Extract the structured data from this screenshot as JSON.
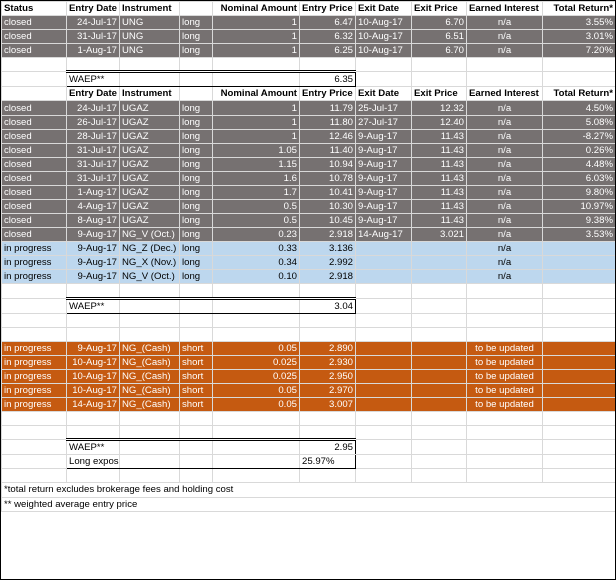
{
  "headers": [
    "Status",
    "Entry Date",
    "Instrument",
    "",
    "Nominal Amount",
    "Entry Price",
    "Exit Date",
    "Exit Price",
    "Earned Interest",
    "Total Return*"
  ],
  "sec1": [
    {
      "status": "closed",
      "entry_date": "24-Jul-17",
      "instrument": "UNG",
      "side": "long",
      "nominal": "1",
      "entry_price": "6.47",
      "exit_date": "10-Aug-17",
      "exit_price": "6.70",
      "interest": "n/a",
      "ret": "3.55%"
    },
    {
      "status": "closed",
      "entry_date": "31-Jul-17",
      "instrument": "UNG",
      "side": "long",
      "nominal": "1",
      "entry_price": "6.32",
      "exit_date": "10-Aug-17",
      "exit_price": "6.51",
      "interest": "n/a",
      "ret": "3.01%"
    },
    {
      "status": "closed",
      "entry_date": "1-Aug-17",
      "instrument": "UNG",
      "side": "long",
      "nominal": "1",
      "entry_price": "6.25",
      "exit_date": "10-Aug-17",
      "exit_price": "6.70",
      "interest": "n/a",
      "ret": "7.20%"
    }
  ],
  "waep1": {
    "label": "WAEP**",
    "value": "6.35"
  },
  "headers2": [
    "",
    "Entry Date",
    "Instrument",
    "",
    "Nominal Amount",
    "Entry Price",
    "Exit Date",
    "Exit Price",
    "Earned Interest",
    "Total Return*"
  ],
  "sec2_closed": [
    {
      "status": "closed",
      "entry_date": "24-Jul-17",
      "instrument": "UGAZ",
      "side": "long",
      "nominal": "1",
      "entry_price": "11.79",
      "exit_date": "25-Jul-17",
      "exit_price": "12.32",
      "interest": "n/a",
      "ret": "4.50%"
    },
    {
      "status": "closed",
      "entry_date": "26-Jul-17",
      "instrument": "UGAZ",
      "side": "long",
      "nominal": "1",
      "entry_price": "11.80",
      "exit_date": "27-Jul-17",
      "exit_price": "12.40",
      "interest": "n/a",
      "ret": "5.08%"
    },
    {
      "status": "closed",
      "entry_date": "28-Jul-17",
      "instrument": "UGAZ",
      "side": "long",
      "nominal": "1",
      "entry_price": "12.46",
      "exit_date": "9-Aug-17",
      "exit_price": "11.43",
      "interest": "n/a",
      "ret": "-8.27%"
    },
    {
      "status": "closed",
      "entry_date": "31-Jul-17",
      "instrument": "UGAZ",
      "side": "long",
      "nominal": "1.05",
      "entry_price": "11.40",
      "exit_date": "9-Aug-17",
      "exit_price": "11.43",
      "interest": "n/a",
      "ret": "0.26%"
    },
    {
      "status": "closed",
      "entry_date": "31-Jul-17",
      "instrument": "UGAZ",
      "side": "long",
      "nominal": "1.15",
      "entry_price": "10.94",
      "exit_date": "9-Aug-17",
      "exit_price": "11.43",
      "interest": "n/a",
      "ret": "4.48%"
    },
    {
      "status": "closed",
      "entry_date": "31-Jul-17",
      "instrument": "UGAZ",
      "side": "long",
      "nominal": "1.6",
      "entry_price": "10.78",
      "exit_date": "9-Aug-17",
      "exit_price": "11.43",
      "interest": "n/a",
      "ret": "6.03%"
    },
    {
      "status": "closed",
      "entry_date": "1-Aug-17",
      "instrument": "UGAZ",
      "side": "long",
      "nominal": "1.7",
      "entry_price": "10.41",
      "exit_date": "9-Aug-17",
      "exit_price": "11.43",
      "interest": "n/a",
      "ret": "9.80%"
    },
    {
      "status": "closed",
      "entry_date": "4-Aug-17",
      "instrument": "UGAZ",
      "side": "long",
      "nominal": "0.5",
      "entry_price": "10.30",
      "exit_date": "9-Aug-17",
      "exit_price": "11.43",
      "interest": "n/a",
      "ret": "10.97%"
    },
    {
      "status": "closed",
      "entry_date": "8-Aug-17",
      "instrument": "UGAZ",
      "side": "long",
      "nominal": "0.5",
      "entry_price": "10.45",
      "exit_date": "9-Aug-17",
      "exit_price": "11.43",
      "interest": "n/a",
      "ret": "9.38%"
    },
    {
      "status": "closed",
      "entry_date": "9-Aug-17",
      "instrument": "NG_V (Oct.)",
      "side": "long",
      "nominal": "0.23",
      "entry_price": "2.918",
      "exit_date": "14-Aug-17",
      "exit_price": "3.021",
      "interest": "n/a",
      "ret": "3.53%"
    }
  ],
  "sec2_progress": [
    {
      "status": "in progress",
      "entry_date": "9-Aug-17",
      "instrument": "NG_Z (Dec.)",
      "side": "long",
      "nominal": "0.33",
      "entry_price": "3.136",
      "interest": "n/a"
    },
    {
      "status": "in progress",
      "entry_date": "9-Aug-17",
      "instrument": "NG_X (Nov.)",
      "side": "long",
      "nominal": "0.34",
      "entry_price": "2.992",
      "interest": "n/a"
    },
    {
      "status": "in progress",
      "entry_date": "9-Aug-17",
      "instrument": "NG_V (Oct.)",
      "side": "long",
      "nominal": "0.10",
      "entry_price": "2.918",
      "interest": "n/a"
    }
  ],
  "waep2": {
    "label": "WAEP**",
    "value": "3.04"
  },
  "sec3": [
    {
      "status": "in progress",
      "entry_date": "9-Aug-17",
      "instrument": "NG_(Cash)",
      "side": "short",
      "nominal": "0.05",
      "entry_price": "2.890",
      "interest": "to be updated"
    },
    {
      "status": "in progress",
      "entry_date": "10-Aug-17",
      "instrument": "NG_(Cash)",
      "side": "short",
      "nominal": "0.025",
      "entry_price": "2.930",
      "interest": "to be updated"
    },
    {
      "status": "in progress",
      "entry_date": "10-Aug-17",
      "instrument": "NG_(Cash)",
      "side": "short",
      "nominal": "0.025",
      "entry_price": "2.950",
      "interest": "to be updated"
    },
    {
      "status": "in progress",
      "entry_date": "10-Aug-17",
      "instrument": "NG_(Cash)",
      "side": "short",
      "nominal": "0.05",
      "entry_price": "2.970",
      "interest": "to be updated"
    },
    {
      "status": "in progress",
      "entry_date": "14-Aug-17",
      "instrument": "NG_(Cash)",
      "side": "short",
      "nominal": "0.05",
      "entry_price": "3.007",
      "interest": "to be updated"
    }
  ],
  "waep3": {
    "label": "WAEP**",
    "value": "2.95",
    "cover_label": "Long exposure covered",
    "cover_value": "25.97%"
  },
  "footnotes": {
    "note1": "*total return excludes brokerage fees and holding cost",
    "note2": "** weighted average entry price"
  },
  "colors": {
    "closed_row": "#767171",
    "progress_row": "#bdd7ee",
    "short_row": "#c55a11",
    "positive": "#70ad47",
    "negative": "#f4b183"
  }
}
